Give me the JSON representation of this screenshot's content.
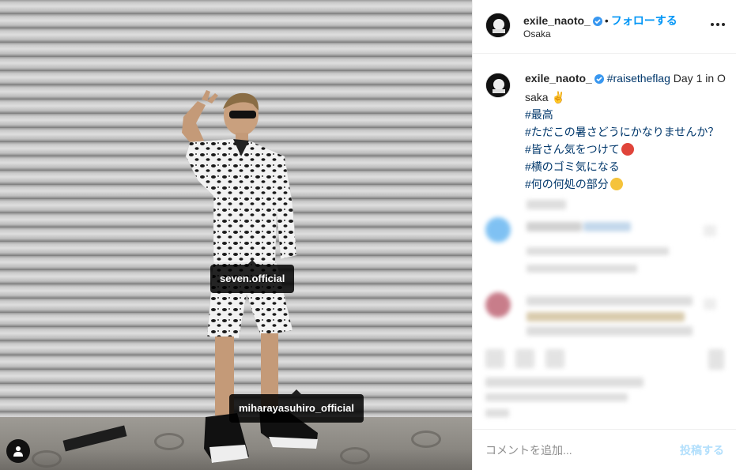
{
  "photo": {
    "tags": [
      {
        "username": "seven.official"
      },
      {
        "username": "miharayasuhiro_official"
      }
    ]
  },
  "header": {
    "username": "exile_naoto_",
    "follow_label": "フォローする",
    "separator": "•",
    "location": "Osaka"
  },
  "caption": {
    "username": "exile_naoto_",
    "lines": [
      {
        "hashtag": "#raisetheflag",
        "text": " Day 1 in Osaka ✌"
      },
      {
        "hashtag": "#最高",
        "text": ""
      },
      {
        "hashtag": "#ただこの暑さどうにかなりませんか？",
        "text": ""
      },
      {
        "hashtag": "#皆さん気をつけて",
        "text": ""
      },
      {
        "hashtag": "#横のゴミ気になる",
        "text": ""
      },
      {
        "hashtag": "#何の何処の部分",
        "text": ""
      }
    ]
  },
  "add_comment": {
    "placeholder": "コメントを追加...",
    "post_label": "投稿する"
  },
  "colors": {
    "accent": "#0095f6",
    "hashtag": "#00376b",
    "post_disabled": "#b2dffc",
    "emoji_angry": "#e0443a",
    "emoji_think": "#f5c33b"
  }
}
